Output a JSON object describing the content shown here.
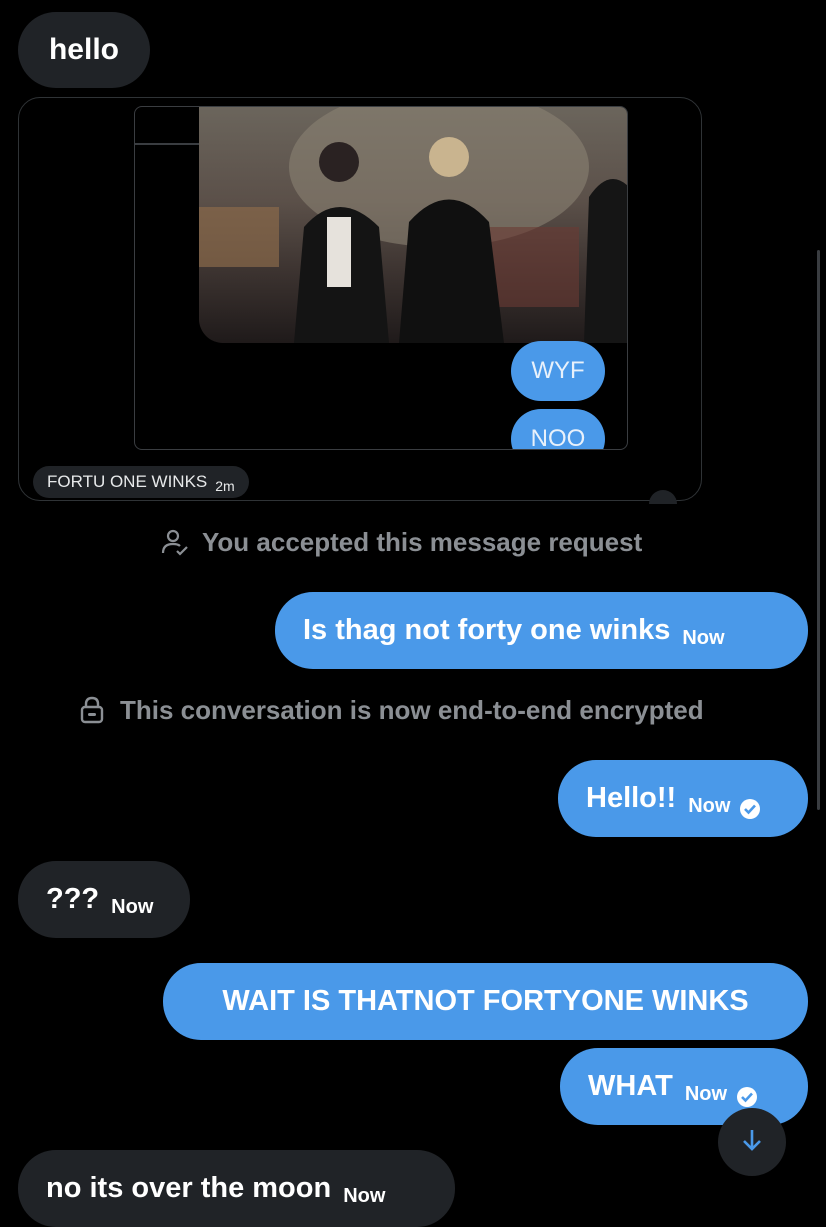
{
  "messages": {
    "hello": "hello",
    "share_caption": "FORTU ONE WINKS",
    "share_time": "2m",
    "embedded_bubble_1": "WYF",
    "embedded_bubble_2": "NOO",
    "accepted_notice": "You accepted this message request",
    "out1_text": "Is thag not forty one winks",
    "out1_time": "Now",
    "encrypted_notice": "This conversation is now end-to-end encrypted",
    "out2_text": "Hello!!",
    "out2_time": "Now",
    "in1_text": "???",
    "in1_time": "Now",
    "out3_text": "WAIT IS THATNOT FORTYONE WINKS",
    "out4_text": "WHAT",
    "out4_time": "Now",
    "in2_text": "no its over the moon",
    "in2_time": "Now"
  },
  "icons": {
    "person_check": "person-check-icon",
    "lock": "lock-icon",
    "scroll_down": "arrow-down-icon",
    "read_receipt": "check-circle-icon"
  },
  "colors": {
    "background": "#000000",
    "incoming_bubble": "#202327",
    "outgoing_bubble": "#4a99e9",
    "system_text": "#8b8f94"
  }
}
